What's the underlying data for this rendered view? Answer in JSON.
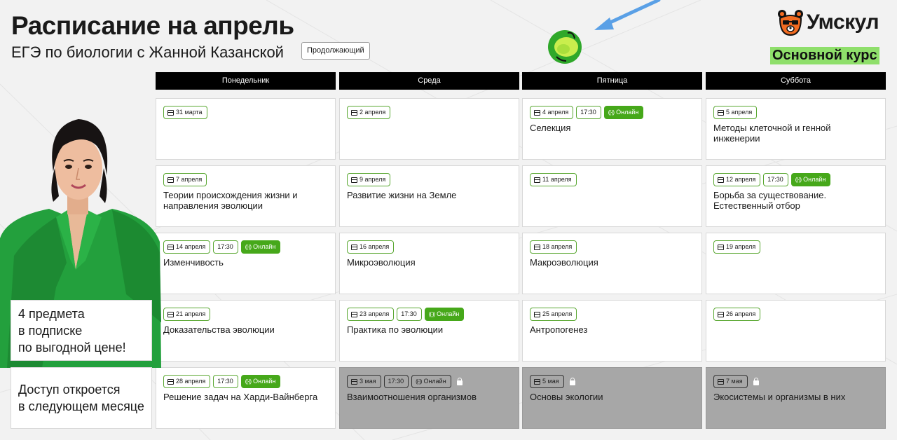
{
  "header": {
    "title": "Расписание на апрель",
    "subtitle": "ЕГЭ по биологии с Жанной Казанской",
    "tag": "Продолжающий"
  },
  "brand": {
    "logo_text": "Умскул",
    "course_label": "Основной курс",
    "accent": "#46a81a",
    "highlight": "#8fdf6b"
  },
  "days": [
    "Понедельник",
    "Среда",
    "Пятница",
    "Суббота"
  ],
  "schedule": [
    [
      {
        "date": "31 марта",
        "time": "",
        "online": "",
        "title": ""
      },
      {
        "date": "2 апреля",
        "time": "",
        "online": "",
        "title": ""
      },
      {
        "date": "4 апреля",
        "time": "17:30",
        "online": "Онлайн",
        "title": "Селекция"
      },
      {
        "date": "5 апреля",
        "time": "",
        "online": "",
        "title": "Методы клеточной и генной инженерии"
      }
    ],
    [
      {
        "date": "7 апреля",
        "time": "",
        "online": "",
        "title": "Теории происхождения жизни и направления эволюции"
      },
      {
        "date": "9 апреля",
        "time": "",
        "online": "",
        "title": "Развитие жизни на Земле"
      },
      {
        "date": "11 апреля",
        "time": "",
        "online": "",
        "title": ""
      },
      {
        "date": "12 апреля",
        "time": "17:30",
        "online": "Онлайн",
        "title": "Борьба за существование. Естественный отбор"
      }
    ],
    [
      {
        "date": "14 апреля",
        "time": "17:30",
        "online": "Онлайн",
        "title": "Изменчивость"
      },
      {
        "date": "16 апреля",
        "time": "",
        "online": "",
        "title": "Микроэволюция"
      },
      {
        "date": "18 апреля",
        "time": "",
        "online": "",
        "title": "Макроэволюция"
      },
      {
        "date": "19 апреля",
        "time": "",
        "online": "",
        "title": ""
      }
    ],
    [
      {
        "date": "21 апреля",
        "time": "",
        "online": "",
        "title": "Доказательства эволюции"
      },
      {
        "date": "23 апреля",
        "time": "17:30",
        "online": "Онлайн",
        "title": "Практика по эволюции"
      },
      {
        "date": "25 апреля",
        "time": "",
        "online": "",
        "title": "Антропогенез"
      },
      {
        "date": "26 апреля",
        "time": "",
        "online": "",
        "title": ""
      }
    ],
    [
      {
        "date": "28 апреля",
        "time": "17:30",
        "online": "Онлайн",
        "title": "Решение задач на Харди-Вайнберга"
      },
      {
        "date": "3 мая",
        "time": "17:30",
        "online": "Онлайн",
        "title": "Взаимоотношения организмов",
        "locked": true
      },
      {
        "date": "5 мая",
        "time": "",
        "online": "",
        "title": "Основы экологии",
        "locked": true
      },
      {
        "date": "7 мая",
        "time": "",
        "online": "",
        "title": "Экосистемы и организмы в них",
        "locked": true
      }
    ]
  ],
  "promo": {
    "subscription_lines": [
      "4 предмета",
      "в подписке",
      "по выгодной цене!"
    ],
    "access_lines": [
      "Доступ откроется",
      "в следующем месяце"
    ]
  }
}
